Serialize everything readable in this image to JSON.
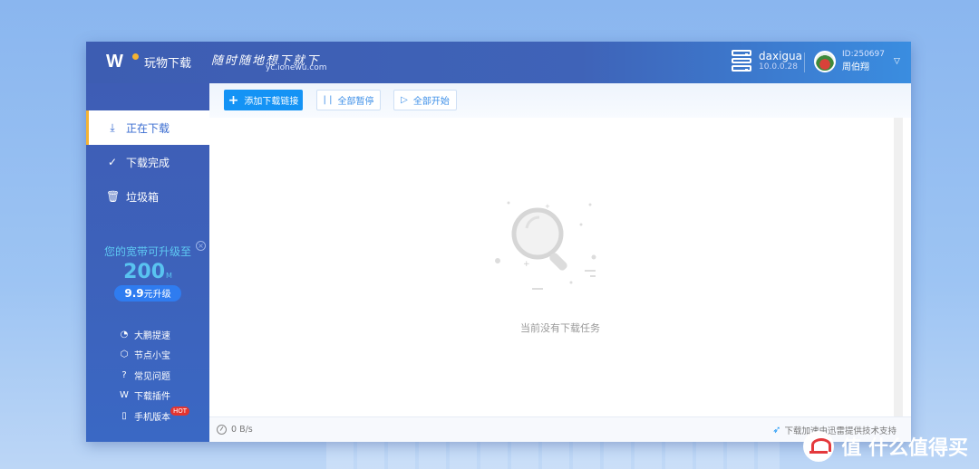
{
  "app": {
    "name": "玩物下载",
    "slogan": "随时随地想下就下",
    "slogan_url": "yc.ionewu.com"
  },
  "device": {
    "name": "daxigua",
    "ip": "10.0.0.28"
  },
  "user": {
    "id": "ID:250697",
    "name": "周伯翔"
  },
  "sidebar": {
    "items": [
      {
        "label": "正在下载",
        "icon": "download-icon",
        "active": true
      },
      {
        "label": "下载完成",
        "icon": "check-circle-icon",
        "active": false
      },
      {
        "label": "垃圾箱",
        "icon": "trash-icon",
        "active": false
      }
    ],
    "promo": {
      "title": "您的宽带可升级至",
      "speed": "200",
      "speed_unit": "M",
      "price": "9.9",
      "price_suffix": "元升级"
    },
    "links": [
      {
        "label": "大鹏提速",
        "icon": "speed-up-icon"
      },
      {
        "label": "节点小宝",
        "icon": "node-icon"
      },
      {
        "label": "常见问题",
        "icon": "question-icon"
      },
      {
        "label": "下载插件",
        "icon": "plugin-icon"
      },
      {
        "label": "手机版本",
        "icon": "phone-icon",
        "badge": "HOT"
      }
    ]
  },
  "toolbar": {
    "add_label": "添加下载链接",
    "pause_all_label": "全部暂停",
    "start_all_label": "全部开始"
  },
  "main": {
    "empty_text": "当前没有下载任务"
  },
  "status": {
    "speed": "0 B/s",
    "credit": "下载加速由迅雷提供技术支持"
  },
  "watermark": {
    "text": "值 什么值得买"
  },
  "colors": {
    "primary": "#1493f5",
    "sidebar": "#3e5db5",
    "accent": "#f5b332"
  }
}
